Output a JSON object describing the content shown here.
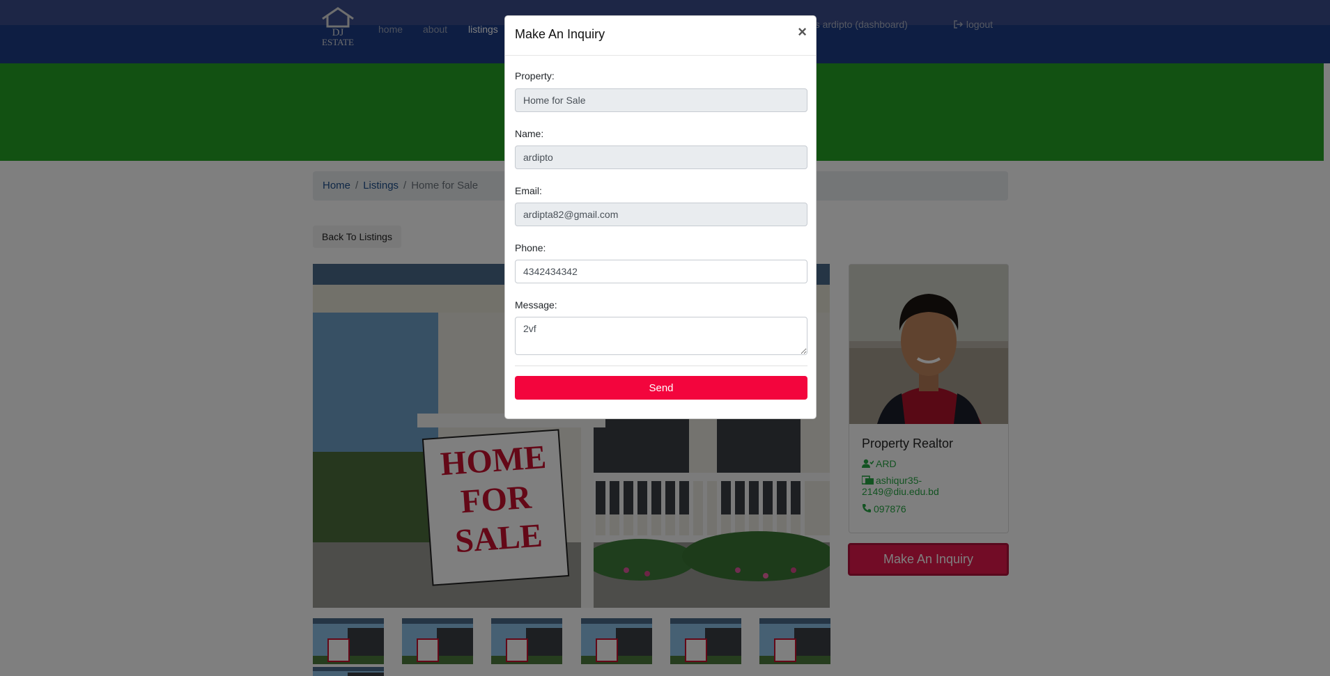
{
  "nav": {
    "brand_line1": "DJ",
    "brand_line2": "ESTATE",
    "links": [
      "home",
      "about",
      "listings"
    ],
    "user_text": "welcomed as ardipto (dashboard)",
    "logout": "logout"
  },
  "breadcrumb": {
    "home": "Home",
    "listings": "Listings",
    "current": "Home for Sale"
  },
  "back_button": "Back To Listings",
  "photo_sign": {
    "line1": "HOME",
    "line2": "FOR",
    "line3": "SALE"
  },
  "realtor": {
    "title": "Property Realtor",
    "name": "ARD",
    "email_line1": "ashiqur35-",
    "email_line2": "2149@diu.edu.bd",
    "phone": "097876"
  },
  "inquiry_button": "Make An Inquiry",
  "modal": {
    "title": "Make An Inquiry",
    "close": "×",
    "property_label": "Property:",
    "property_value": "Home for Sale",
    "name_label": "Name:",
    "name_value": "ardipto",
    "email_label": "Email:",
    "email_value": "ardipta82@gmail.com",
    "phone_label": "Phone:",
    "phone_value": "4342434342",
    "message_label": "Message:",
    "message_value": "2vf",
    "send": "Send"
  },
  "colors": {
    "navbar": "#1c3c86",
    "showcase": "#24a324",
    "accent": "#f3053d",
    "realtor_text": "#27a744"
  }
}
